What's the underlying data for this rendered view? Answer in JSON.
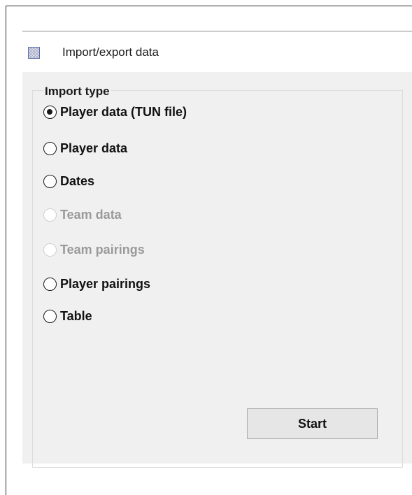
{
  "window": {
    "title": "Import/export data",
    "icon": "app-icon"
  },
  "import_type": {
    "label": "Import type",
    "options": [
      {
        "label": "Player data (TUN file)",
        "checked": true,
        "enabled": true
      },
      {
        "label": "Player data",
        "checked": false,
        "enabled": true
      },
      {
        "label": "Dates",
        "checked": false,
        "enabled": true
      },
      {
        "label": "Team data",
        "checked": false,
        "enabled": false
      },
      {
        "label": "Team pairings",
        "checked": false,
        "enabled": false
      },
      {
        "label": "Player pairings",
        "checked": false,
        "enabled": true
      },
      {
        "label": "Table",
        "checked": false,
        "enabled": true
      }
    ]
  },
  "actions": {
    "start_label": "Start"
  },
  "colors": {
    "client_background": "#f0f0f0",
    "disabled_text": "#9a9a9a",
    "button_background": "#e6e6e6"
  }
}
